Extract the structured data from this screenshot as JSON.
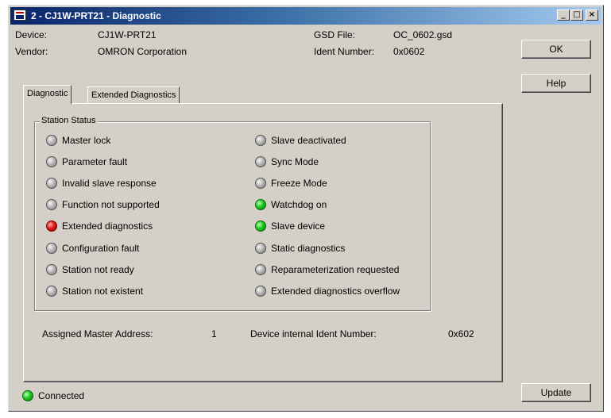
{
  "window": {
    "title": "2 - CJ1W-PRT21 - Diagnostic",
    "controls": {
      "minimize": "_",
      "maximize": "□",
      "close": "×"
    }
  },
  "device": {
    "device_label": "Device:",
    "device_value": "CJ1W-PRT21",
    "vendor_label": "Vendor:",
    "vendor_value": "OMRON Corporation",
    "gsd_label": "GSD File:",
    "gsd_value": "OC_0602.gsd",
    "ident_label": "Ident Number:",
    "ident_value": "0x0602"
  },
  "buttons": {
    "ok": "OK",
    "help": "Help",
    "update": "Update"
  },
  "tabs": [
    {
      "label": "Diagnostic",
      "active": true
    },
    {
      "label": "Extended Diagnostics",
      "active": false
    }
  ],
  "station_status": {
    "title": "Station Status",
    "left": [
      {
        "label": "Master lock",
        "state": "grey"
      },
      {
        "label": "Parameter fault",
        "state": "grey"
      },
      {
        "label": "Invalid slave response",
        "state": "grey"
      },
      {
        "label": "Function not supported",
        "state": "grey"
      },
      {
        "label": "Extended diagnostics",
        "state": "red"
      },
      {
        "label": "Configuration fault",
        "state": "grey"
      },
      {
        "label": "Station not ready",
        "state": "grey"
      },
      {
        "label": "Station not existent",
        "state": "grey"
      }
    ],
    "right": [
      {
        "label": "Slave deactivated",
        "state": "grey"
      },
      {
        "label": "Sync Mode",
        "state": "grey"
      },
      {
        "label": "Freeze Mode",
        "state": "grey"
      },
      {
        "label": "Watchdog on",
        "state": "green"
      },
      {
        "label": "Slave device",
        "state": "green"
      },
      {
        "label": "Static diagnostics",
        "state": "grey"
      },
      {
        "label": "Reparameterization requested",
        "state": "grey"
      },
      {
        "label": "Extended diagnostics overflow",
        "state": "grey"
      }
    ]
  },
  "addresses": {
    "master_label": "Assigned Master Address:",
    "master_value": "1",
    "ident_label": "Device internal Ident Number:",
    "ident_value": "0x602"
  },
  "connection": {
    "label": "Connected",
    "state": "green"
  }
}
